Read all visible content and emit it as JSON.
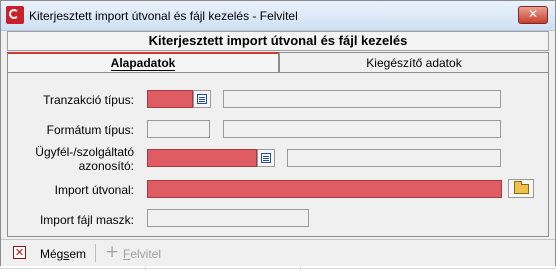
{
  "window": {
    "title": "Kiterjesztett import útvonal és fájl kezelés - Felvitel",
    "close_glyph": "✕",
    "app_icon": "app-logo-icon"
  },
  "header": {
    "title": "Kiterjesztett import útvonal és fájl kezelés"
  },
  "tabs": [
    {
      "label": "Alapadatok",
      "active": true
    },
    {
      "label": "Kiegészítő adatok",
      "active": false
    }
  ],
  "form": {
    "tranzakcio_tipus": {
      "label": "Tranzakció típus:",
      "value": "",
      "description": ""
    },
    "formatum_tipus": {
      "label": "Formátum típus:",
      "value": "",
      "description": ""
    },
    "ugyfel_azonosito": {
      "label_line1": "Ügyfél-/szolgáltató",
      "label_line2": "azonosító:",
      "value": "",
      "description": ""
    },
    "import_utvonal": {
      "label": "Import útvonal:",
      "value": ""
    },
    "import_fajl_maszk": {
      "label": "Import fájl maszk:",
      "value": ""
    }
  },
  "toolbar": {
    "cancel_label_pre": "Még",
    "cancel_label_underlined": "s",
    "cancel_label_post": "em",
    "cancel_glyph": "✕",
    "add_glyph": "+",
    "add_label_underlined": "F",
    "add_label_post": "elvitel"
  },
  "colors": {
    "required_field": "#e05c63",
    "active_tab_accent": "#d23838",
    "titlebar": "#d6e5f5"
  }
}
